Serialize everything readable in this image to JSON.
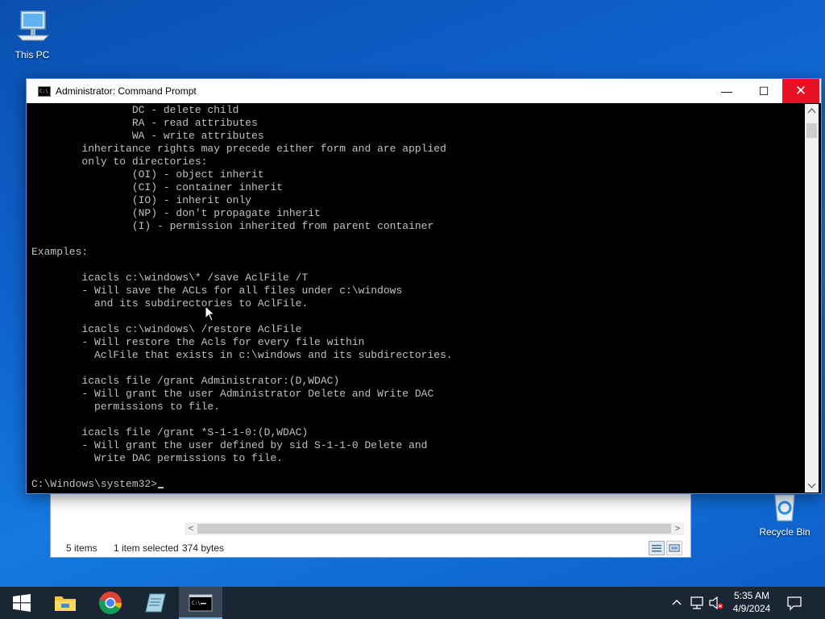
{
  "desktop": {
    "icons": [
      {
        "label": "This PC",
        "icon": "computer-icon"
      },
      {
        "label": "Recycle Bin",
        "icon": "recycle-bin-icon"
      }
    ]
  },
  "explorer": {
    "status_items": "5 items",
    "status_selected": "1 item selected",
    "status_size": "374 bytes",
    "scroll_left": "<",
    "scroll_right": ">"
  },
  "cmd": {
    "title": "Administrator: Command Prompt",
    "controls": {
      "minimize": "—",
      "maximize": "☐",
      "close": "✕"
    },
    "lines": [
      "                DC - delete child",
      "                RA - read attributes",
      "                WA - write attributes",
      "        inheritance rights may precede either form and are applied",
      "        only to directories:",
      "                (OI) - object inherit",
      "                (CI) - container inherit",
      "                (IO) - inherit only",
      "                (NP) - don't propagate inherit",
      "                (I) - permission inherited from parent container",
      "",
      "Examples:",
      "",
      "        icacls c:\\windows\\* /save AclFile /T",
      "        - Will save the ACLs for all files under c:\\windows",
      "          and its subdirectories to AclFile.",
      "",
      "        icacls c:\\windows\\ /restore AclFile",
      "        - Will restore the Acls for every file within",
      "          AclFile that exists in c:\\windows and its subdirectories.",
      "",
      "        icacls file /grant Administrator:(D,WDAC)",
      "        - Will grant the user Administrator Delete and Write DAC",
      "          permissions to file.",
      "",
      "        icacls file /grant *S-1-1-0:(D,WDAC)",
      "        - Will grant the user defined by sid S-1-1-0 Delete and",
      "          Write DAC permissions to file.",
      ""
    ],
    "prompt": "C:\\Windows\\system32>"
  },
  "taskbar": {
    "apps": [
      {
        "name": "start",
        "icon": "windows-logo-icon"
      },
      {
        "name": "file-explorer",
        "icon": "folder-icon"
      },
      {
        "name": "chrome",
        "icon": "chrome-icon"
      },
      {
        "name": "notepad",
        "icon": "notepad-icon"
      },
      {
        "name": "command-prompt",
        "icon": "cmd-icon",
        "active": true
      }
    ],
    "tray_icons": [
      "chevron-up-icon",
      "network-icon",
      "volume-muted-icon",
      "notification-icon"
    ],
    "time": "5:35 AM",
    "date": "4/9/2024"
  },
  "colors": {
    "console_text": "#c0c0c0",
    "console_bg": "#000000",
    "close_button": "#e81123",
    "taskbar": "#1b2635"
  }
}
